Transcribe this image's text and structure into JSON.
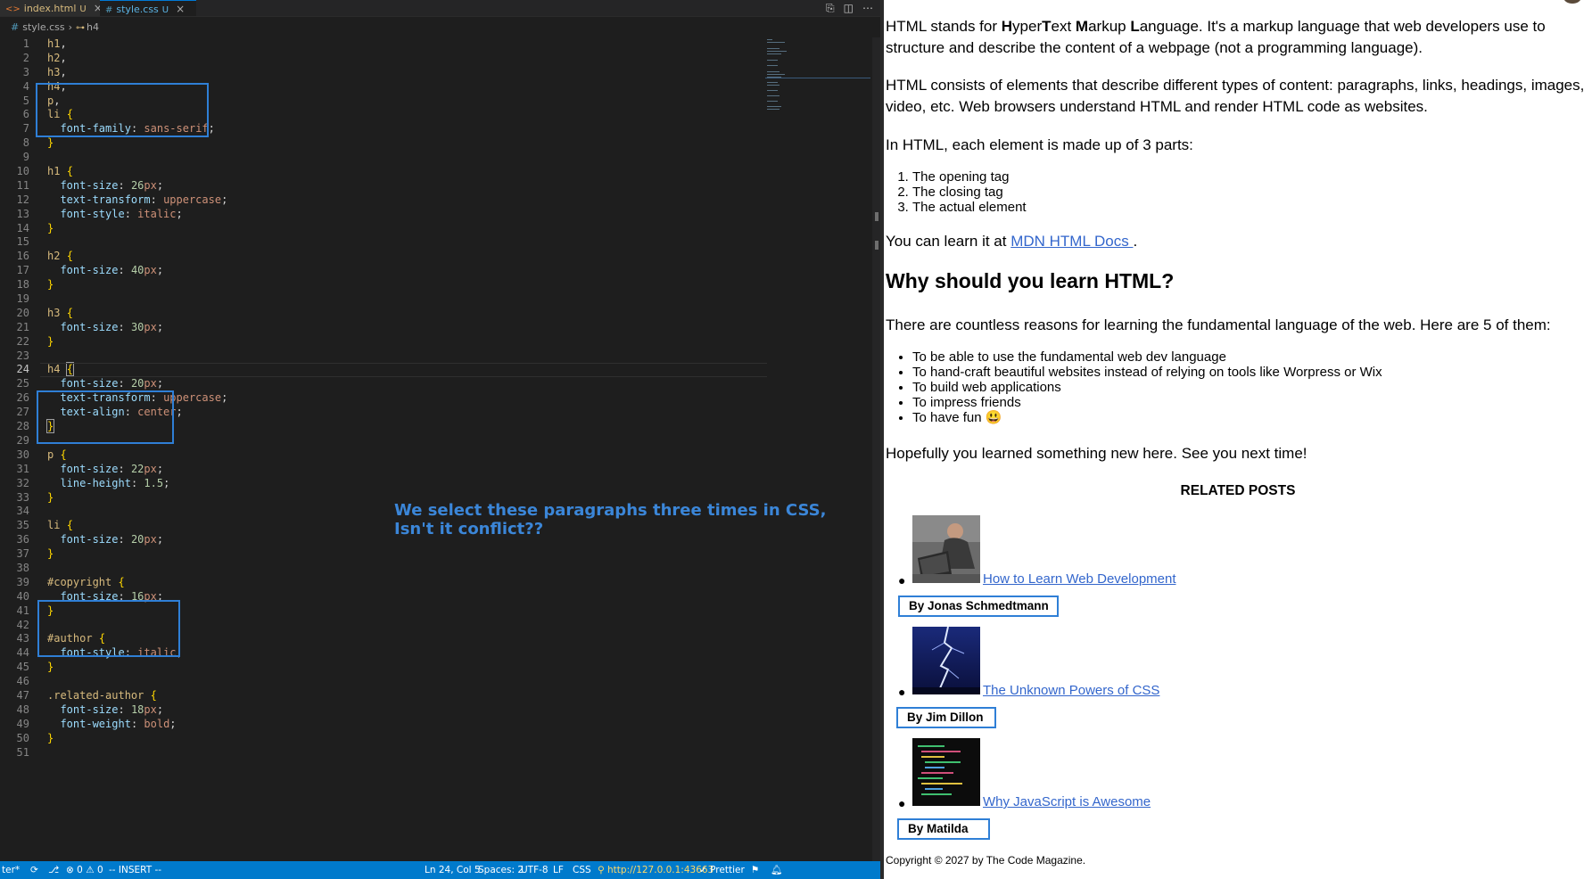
{
  "editor": {
    "tabs": [
      {
        "label": "index.html",
        "icon": "html-file-icon",
        "mark": "U"
      },
      {
        "label": "style.css",
        "icon": "css-file-icon",
        "mark": "U",
        "active": true
      }
    ],
    "breadcrumb": {
      "file": "style.css",
      "symbol": "h4"
    },
    "code_lines": [
      {
        "n": "1",
        "t": "h1,"
      },
      {
        "n": "2",
        "t": "h2,"
      },
      {
        "n": "3",
        "t": "h3,"
      },
      {
        "n": "4",
        "t": "h4,"
      },
      {
        "n": "5",
        "t": "p,"
      },
      {
        "n": "6",
        "t": "li {"
      },
      {
        "n": "7",
        "t": "  font-family: sans-serif;"
      },
      {
        "n": "8",
        "t": "}"
      },
      {
        "n": "9",
        "t": ""
      },
      {
        "n": "10",
        "t": "h1 {"
      },
      {
        "n": "11",
        "t": "  font-size: 26px;"
      },
      {
        "n": "12",
        "t": "  text-transform: uppercase;"
      },
      {
        "n": "13",
        "t": "  font-style: italic;"
      },
      {
        "n": "14",
        "t": "}"
      },
      {
        "n": "15",
        "t": ""
      },
      {
        "n": "16",
        "t": "h2 {"
      },
      {
        "n": "17",
        "t": "  font-size: 40px;"
      },
      {
        "n": "18",
        "t": "}"
      },
      {
        "n": "19",
        "t": ""
      },
      {
        "n": "20",
        "t": "h3 {"
      },
      {
        "n": "21",
        "t": "  font-size: 30px;"
      },
      {
        "n": "22",
        "t": "}"
      },
      {
        "n": "23",
        "t": ""
      },
      {
        "n": "24",
        "t": "h4 {"
      },
      {
        "n": "25",
        "t": "  font-size: 20px;"
      },
      {
        "n": "26",
        "t": "  text-transform: uppercase;"
      },
      {
        "n": "27",
        "t": "  text-align: center;"
      },
      {
        "n": "28",
        "t": "}"
      },
      {
        "n": "29",
        "t": ""
      },
      {
        "n": "30",
        "t": "p {"
      },
      {
        "n": "31",
        "t": "  font-size: 22px;"
      },
      {
        "n": "32",
        "t": "  line-height: 1.5;"
      },
      {
        "n": "33",
        "t": "}"
      },
      {
        "n": "34",
        "t": ""
      },
      {
        "n": "35",
        "t": "li {"
      },
      {
        "n": "36",
        "t": "  font-size: 20px;"
      },
      {
        "n": "37",
        "t": "}"
      },
      {
        "n": "38",
        "t": ""
      },
      {
        "n": "39",
        "t": "#copyright {"
      },
      {
        "n": "40",
        "t": "  font-size: 16px;"
      },
      {
        "n": "41",
        "t": "}"
      },
      {
        "n": "42",
        "t": ""
      },
      {
        "n": "43",
        "t": "#author {"
      },
      {
        "n": "44",
        "t": "  font-style: italic;"
      },
      {
        "n": "45",
        "t": "}"
      },
      {
        "n": "46",
        "t": ""
      },
      {
        "n": "47",
        "t": ".related-author {"
      },
      {
        "n": "48",
        "t": "  font-size: 18px;"
      },
      {
        "n": "49",
        "t": "  font-weight: bold;"
      },
      {
        "n": "50",
        "t": "}"
      },
      {
        "n": "51",
        "t": ""
      }
    ],
    "active_line": "24",
    "annotation": {
      "line1": "We select these paragraphs three times in CSS,",
      "line2": "Isn't it conflict??",
      "color": "#3b86d8"
    },
    "statusbar": {
      "left_label": "ter*",
      "problems": "0",
      "warnings": "0",
      "mode": "-- INSERT --",
      "position": "Ln 24, Col 5",
      "spaces": "Spaces: 2",
      "encoding": "UTF-8",
      "eol": "LF",
      "language": "CSS",
      "server": "http://127.0.0.1:43663",
      "formatter": "Prettier",
      "color": "#007acc"
    }
  },
  "preview": {
    "intro": {
      "pre": "HTML stands for ",
      "h": "H",
      "yper": "yper",
      "t": "T",
      "ext": "ext ",
      "m": "M",
      "arkup": "arkup ",
      "l": "L",
      "rest": "anguage. It's a markup language that web developers use to structure and describe the content of a webpage (not a programming language)."
    },
    "p2": "HTML consists of elements that describe different types of content: paragraphs, links, headings, images, video, etc. Web browsers understand HTML and render HTML code as websites.",
    "p3": "In HTML, each element is made up of 3 parts:",
    "parts": [
      "The opening tag",
      "The closing tag",
      "The actual element"
    ],
    "learn_prefix": "You can learn it at ",
    "learn_link": "MDN HTML Docs ",
    "learn_suffix": ".",
    "h2": "Why should you learn HTML?",
    "reasons_intro": "There are countless reasons for learning the fundamental language of the web. Here are 5 of them:",
    "reasons": [
      "To be able to use the fundamental web dev language",
      "To hand-craft beautiful websites instead of relying on tools like Worpress or Wix",
      "To build web applications",
      "To impress friends",
      "To have fun 😃"
    ],
    "outro": "Hopefully you learned something new here. See you next time!",
    "related_heading": "RELATED POSTS",
    "related_posts": [
      {
        "title": "How to Learn Web Development",
        "author": "By Jonas Schmedtmann",
        "image": "laptop-photo"
      },
      {
        "title": "The Unknown Powers of CSS",
        "author": "By Jim Dillon",
        "image": "lightning-photo"
      },
      {
        "title": "Why JavaScript is Awesome",
        "author": "By Matilda",
        "image": "code-photo"
      }
    ],
    "copyright": "Copyright © 2027 by The Code Magazine.",
    "link_color": "#3366cc",
    "author_border_color": "#2f7fd6"
  }
}
